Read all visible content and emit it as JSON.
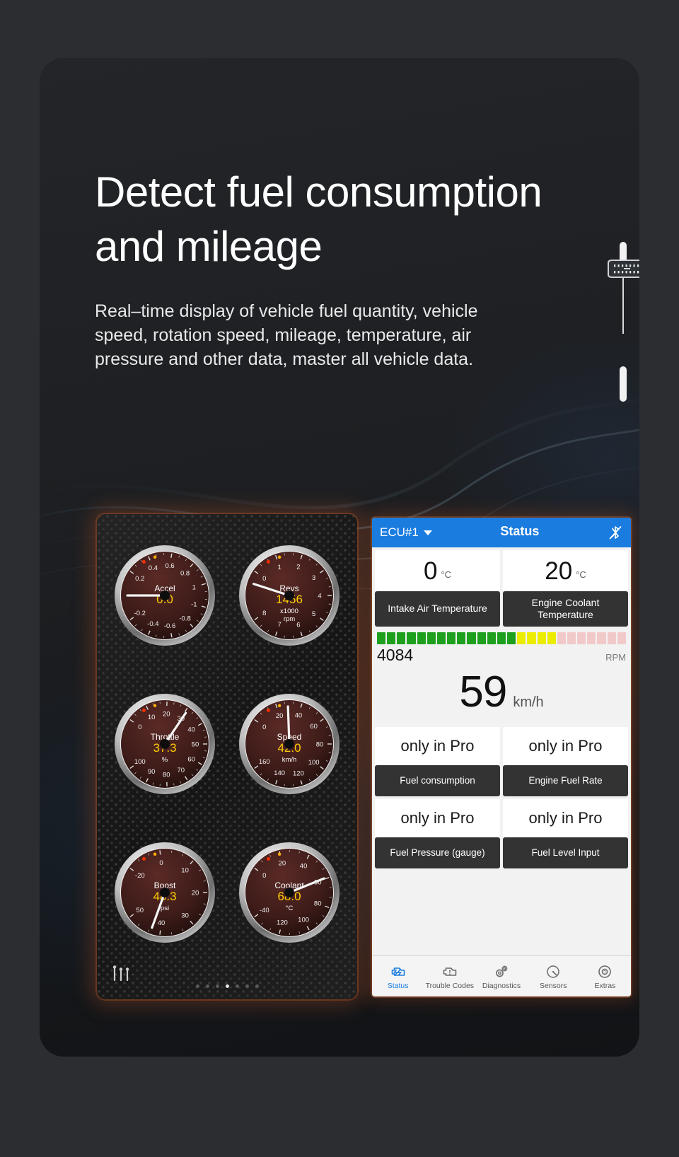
{
  "hero": {
    "headline": "Detect fuel consumption and mileage",
    "subtext": "Real–time display of vehicle fuel quantity, vehicle speed, rotation speed, mileage, temperature, air pressure and other data, master all vehicle data."
  },
  "colors": {
    "accent_blue": "#1b7ce0",
    "glow_orange": "#d25a23",
    "gauge_face": "#3a1a18",
    "gauge_value": "#ffd000",
    "rpm_green": "#1ea01e",
    "rpm_yellow": "#ecec00",
    "rpm_empty": "#f2c9c9",
    "card_bg": "#212326",
    "page_bg": "#2b2d30"
  },
  "gauges": {
    "panel_dots": {
      "count": 7,
      "active_index": 3
    },
    "items": [
      {
        "name": "Accel",
        "value": "0.0",
        "unit": "",
        "ticks": [
          "0.2",
          "0.4",
          "0.6",
          "0.8",
          "1",
          "-1",
          "-0.8",
          "-0.6",
          "-0.4",
          "-0.2"
        ],
        "needle_deg": 180,
        "min": -1,
        "max": 1
      },
      {
        "name": "Revs",
        "value": "1456",
        "unit": "x1000 rpm",
        "ticks": [
          "0",
          "1",
          "2",
          "3",
          "4",
          "5",
          "6",
          "7",
          "8"
        ],
        "needle_deg": 198,
        "min": 0,
        "max": 8
      },
      {
        "name": "Throttle",
        "value": "37.3",
        "unit": "%",
        "ticks": [
          "0",
          "10",
          "20",
          "30",
          "40",
          "50",
          "60",
          "70",
          "80",
          "90",
          "100"
        ],
        "needle_deg": 304,
        "min": 0,
        "max": 100
      },
      {
        "name": "Speed",
        "value": "42.0",
        "unit": "km/h",
        "ticks": [
          "0",
          "20",
          "40",
          "60",
          "80",
          "100",
          "120",
          "140",
          "160"
        ],
        "needle_deg": 268,
        "min": 0,
        "max": 160
      },
      {
        "name": "Boost",
        "value": "48.3",
        "unit": "psi",
        "ticks": [
          "-20",
          "0",
          "10",
          "20",
          "30",
          "40",
          "50"
        ],
        "needle_deg": 110,
        "min": -20,
        "max": 50
      },
      {
        "name": "Coolant",
        "value": "68.0",
        "unit": "°C",
        "ticks": [
          "0",
          "20",
          "40",
          "60",
          "80",
          "100",
          "120",
          "-40"
        ],
        "needle_deg": 338,
        "min": -40,
        "max": 120
      }
    ]
  },
  "phone": {
    "nav": {
      "ecu_label": "ECU#1",
      "title": "Status",
      "right_icon": "bluetooth-disconnected-icon"
    },
    "temp_tiles": [
      {
        "value": "0",
        "unit": "°C",
        "label": "Intake Air Temperature"
      },
      {
        "value": "20",
        "unit": "°C",
        "label": "Engine Coolant Temperature"
      }
    ],
    "rpm": {
      "value": "4084",
      "unit": "RPM",
      "segments_total": 25,
      "segments_green": 14,
      "segments_yellow": 4
    },
    "speed": {
      "value": "59",
      "unit": "km/h"
    },
    "pro_tiles": [
      {
        "value": "only in Pro",
        "label": "Fuel consumption"
      },
      {
        "value": "only in Pro",
        "label": "Engine Fuel Rate"
      },
      {
        "value": "only in Pro",
        "label": "Fuel Pressure (gauge)"
      },
      {
        "value": "only in Pro",
        "label": "Fuel Level Input"
      }
    ],
    "tabs": [
      {
        "label": "Status",
        "icon": "engine-scan-icon",
        "active": true
      },
      {
        "label": "Trouble Codes",
        "icon": "engine-warning-icon",
        "active": false
      },
      {
        "label": "Diagnostics",
        "icon": "gears-icon",
        "active": false
      },
      {
        "label": "Sensors",
        "icon": "gauge-icon",
        "active": false
      },
      {
        "label": "Extras",
        "icon": "lifebuoy-help-icon",
        "active": false
      }
    ]
  }
}
